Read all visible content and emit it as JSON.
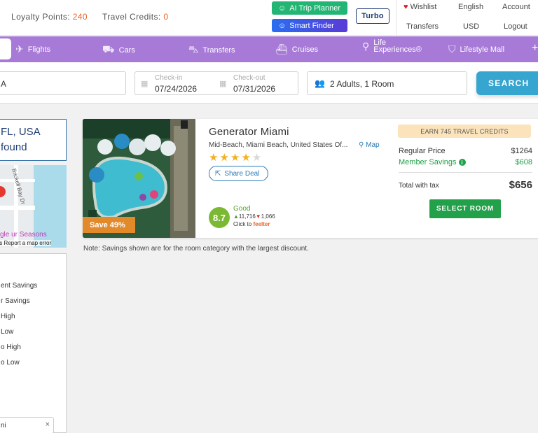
{
  "topbar": {
    "loyalty_label": "Loyalty Points:",
    "loyalty_value": "240",
    "credits_label": "Travel Credits:",
    "credits_value": "0",
    "ai_trip_planner": "AI Trip Planner",
    "smart_finder": "Smart Finder",
    "turbo": "Turbo",
    "wishlist": "Wishlist",
    "language": "English",
    "account": "Account",
    "transfers": "Transfers",
    "currency": "USD",
    "logout": "Logout"
  },
  "nav": {
    "items": [
      {
        "label": "Flights",
        "icon": "plane-icon"
      },
      {
        "label": "Cars",
        "icon": "car-icon"
      },
      {
        "label": "Transfers",
        "icon": "bus-icon"
      },
      {
        "label": "Cruises",
        "icon": "ship-icon"
      },
      {
        "label": "Life",
        "label2": "Experiences®",
        "icon": "balloon-icon"
      },
      {
        "label": "Lifestyle Mall",
        "icon": "shopping-bag-icon"
      }
    ],
    "more": "+"
  },
  "search": {
    "destination": "A",
    "checkin_label": "Check-in",
    "checkin_value": "07/24/2026",
    "checkout_label": "Check-out",
    "checkout_value": "07/31/2026",
    "guests": "2 Adults, 1 Room",
    "search_button": "SEARCH"
  },
  "sidebar": {
    "location_title": "FL, USA",
    "location_sub": "found",
    "map": {
      "street": "Brickell Bay Dr",
      "poi": "gle ur Seasons",
      "footer": "rms  Report a map error"
    },
    "sort_options": [
      "ent Savings",
      "r Savings",
      "High",
      "Low",
      "o High",
      "o Low"
    ],
    "filter_value": "ni",
    "filter_clear": "×"
  },
  "hotel": {
    "name": "Generator Miami",
    "address": "Mid-Beach, Miami Beach, United States Of...",
    "map_link": "Map",
    "stars": 4,
    "stars_max": 5,
    "share": "Share Deal",
    "save_badge": "Save 49%",
    "score": "8.7",
    "score_label": "Good",
    "votes_up": "11,716",
    "votes_down": "1,066",
    "click_to": "Click to",
    "feelter": "feelter",
    "earn_badge": "EARN 745 TRAVEL CREDITS",
    "regular_label": "Regular Price",
    "regular_price": "$1264",
    "member_label": "Member Savings",
    "member_savings": "$608",
    "total_label": "Total with tax",
    "total_price": "$656",
    "select_button": "SELECT ROOM"
  },
  "note": "Note: Savings shown are for the room category with the largest discount."
}
